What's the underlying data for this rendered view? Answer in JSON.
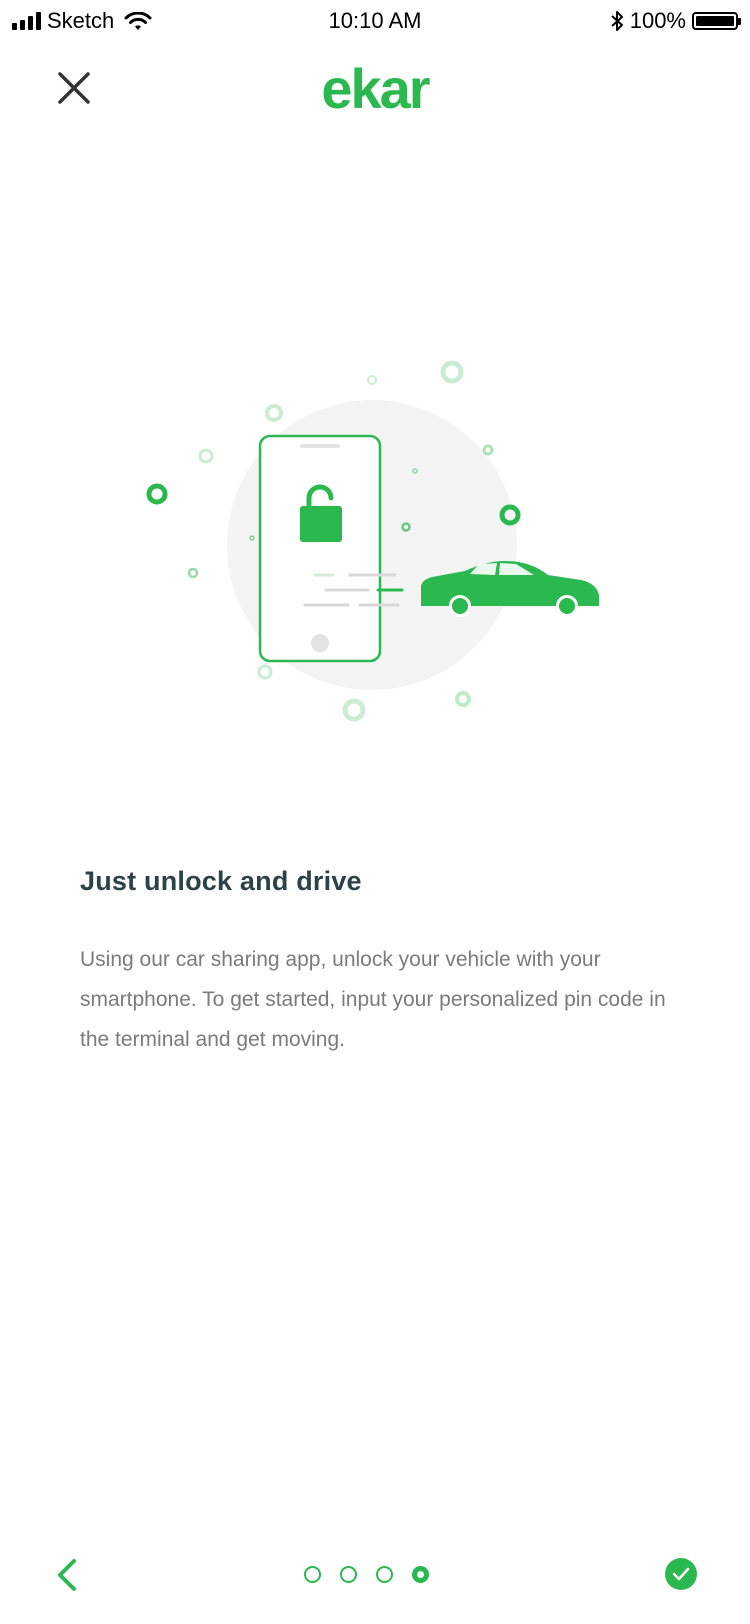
{
  "status_bar": {
    "carrier": "Sketch",
    "time": "10:10 AM",
    "battery": "100%"
  },
  "header": {
    "logo_text": "ekar"
  },
  "onboarding": {
    "title": "Just unlock and drive",
    "description": "Using our car sharing app, unlock your vehicle with your smartphone. To get started, input your personalized pin code in the terminal and get moving."
  },
  "pagination": {
    "total": 4,
    "current": 4
  },
  "colors": {
    "brand": "#2bb94f",
    "title": "#2b4248",
    "body_text": "#7b7b7b"
  },
  "icons": [
    "close-icon",
    "lock-icon",
    "car-icon",
    "chevron-left-icon",
    "check-icon",
    "wifi-icon",
    "bluetooth-icon",
    "battery-icon"
  ]
}
